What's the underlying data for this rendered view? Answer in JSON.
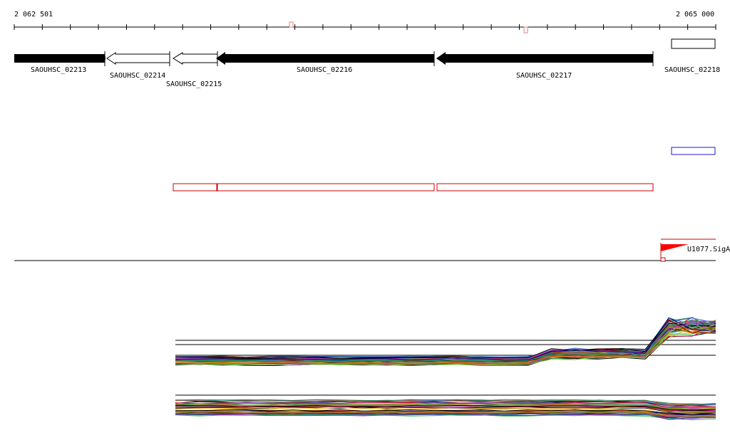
{
  "ruler": {
    "start_label": "2 062 501",
    "end_label": "2 065 000"
  },
  "genes": [
    {
      "name": "SAOUHSC_02213",
      "strand": "+",
      "style": "filled"
    },
    {
      "name": "SAOUHSC_02214",
      "strand": "-",
      "style": "outline"
    },
    {
      "name": "SAOUHSC_02215",
      "strand": "-",
      "style": "outline"
    },
    {
      "name": "SAOUHSC_02216",
      "strand": "-",
      "style": "filled"
    },
    {
      "name": "SAOUHSC_02217",
      "strand": "-",
      "style": "filled"
    },
    {
      "name": "SAOUHSC_02218",
      "strand": "+",
      "style": "outline"
    }
  ],
  "promoter": {
    "label": "U1077.SigA",
    "color": "#ff0000"
  },
  "colors": {
    "gene_fill": "#000000",
    "feature_red": "#cc0000",
    "feature_blue": "#1a1ad6"
  }
}
